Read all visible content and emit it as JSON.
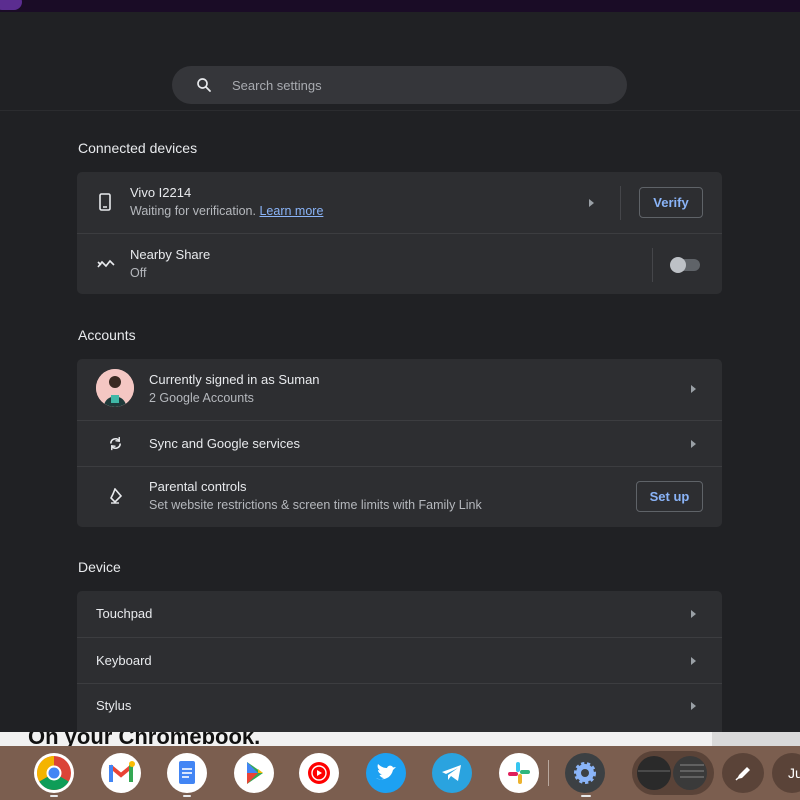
{
  "search": {
    "placeholder": "Search settings"
  },
  "sections": {
    "connected_devices": {
      "title": "Connected devices",
      "phone": {
        "name": "Vivo I2214",
        "status": "Waiting for verification.",
        "link": "Learn more",
        "button": "Verify"
      },
      "nearby_share": {
        "label": "Nearby Share",
        "status": "Off",
        "toggle_on": false
      }
    },
    "accounts": {
      "title": "Accounts",
      "signed_in": {
        "label": "Currently signed in as Suman",
        "sub": "2 Google Accounts"
      },
      "sync": {
        "label": "Sync and Google services"
      },
      "parental": {
        "label": "Parental controls",
        "sub": "Set website restrictions & screen time limits with Family Link",
        "button": "Set up"
      }
    },
    "device": {
      "title": "Device",
      "items": [
        {
          "label": "Touchpad"
        },
        {
          "label": "Keyboard"
        },
        {
          "label": "Stylus"
        }
      ]
    }
  },
  "overlay_text": "On your Chromebook.",
  "shelf": {
    "apps": [
      {
        "name": "chrome-icon"
      },
      {
        "name": "gmail-icon"
      },
      {
        "name": "docs-icon"
      },
      {
        "name": "play-store-icon"
      },
      {
        "name": "youtube-music-icon"
      },
      {
        "name": "twitter-icon"
      },
      {
        "name": "telegram-icon"
      },
      {
        "name": "slack-icon"
      },
      {
        "name": "settings-icon"
      }
    ],
    "clock_text": "Ju"
  },
  "colors": {
    "accent": "#8ab4f8",
    "background": "#202124",
    "card": "#2d2e31",
    "shelf": "#7b5e4f"
  }
}
